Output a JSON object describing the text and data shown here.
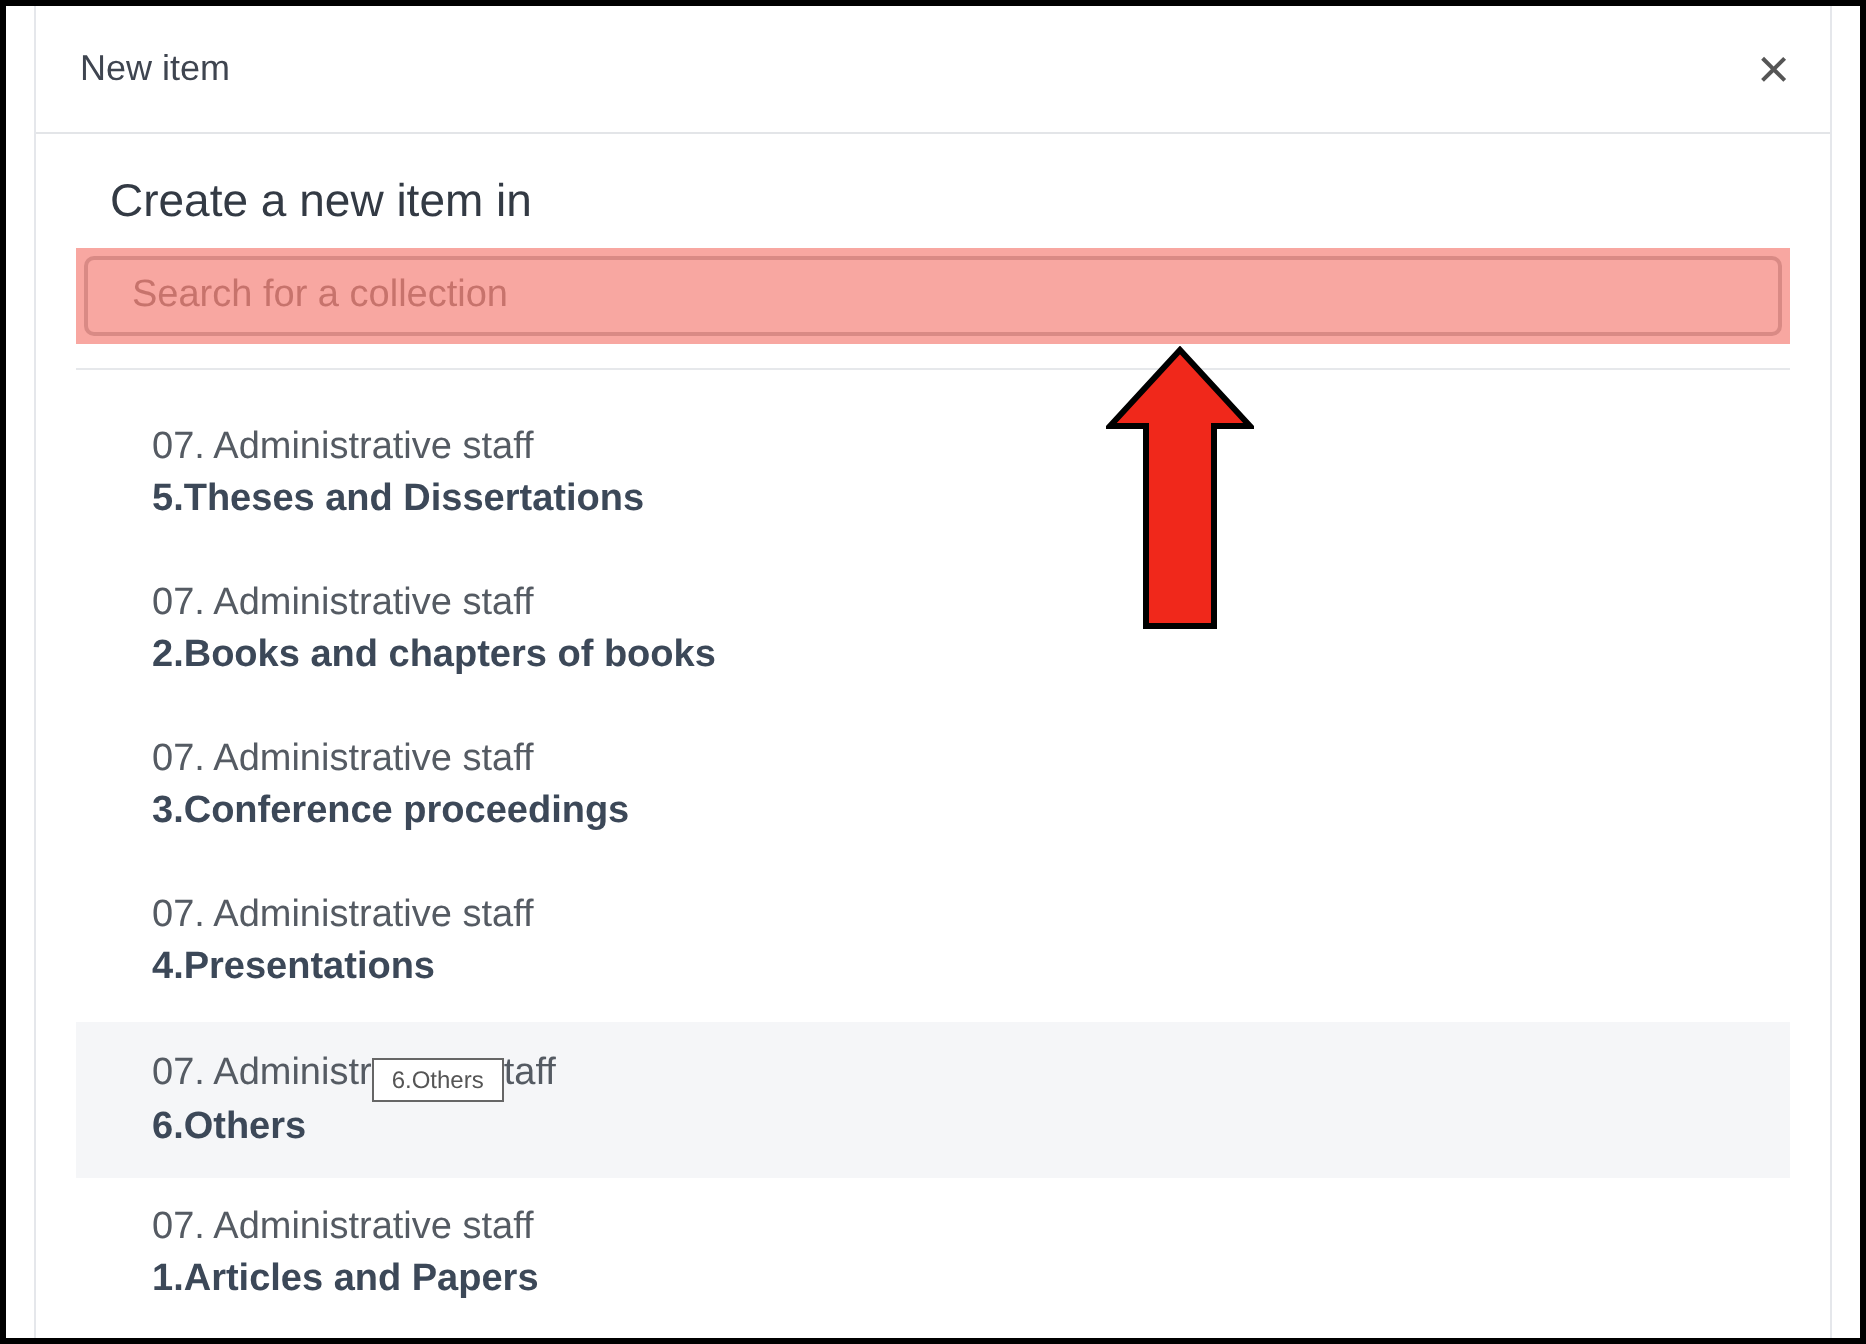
{
  "dialog": {
    "title": "New item",
    "close": "×"
  },
  "heading": "Create a new item in",
  "search": {
    "placeholder": "Search for a collection",
    "highlighted": true
  },
  "items": [
    {
      "kind": "plain",
      "parent": "07. Administrative staff",
      "title": "5.Theses and Dissertations"
    },
    {
      "kind": "plain",
      "parent": "07. Administrative staff",
      "title": "2.Books and chapters of books"
    },
    {
      "kind": "plain",
      "parent": "07. Administrative staff",
      "title": "3.Conference proceedings"
    },
    {
      "kind": "plain",
      "parent": "07. Administrative staff",
      "title": "4.Presentations"
    },
    {
      "kind": "hovered",
      "parent_before": "07. Administr",
      "tooltip": "6.Others",
      "parent_after": "taff",
      "title": "6.Others"
    },
    {
      "kind": "plain",
      "parent": "07. Administrative staff",
      "title": "1.Articles and Papers"
    }
  ]
}
